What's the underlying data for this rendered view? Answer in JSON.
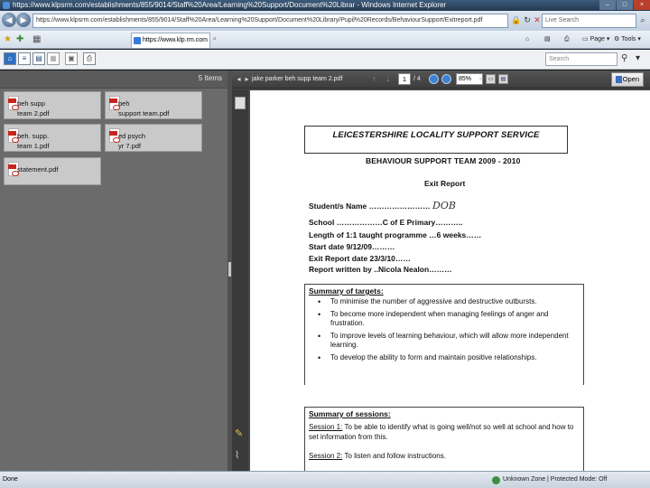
{
  "window": {
    "title": "https://www.klpsrm.com/establishments/855/9014/Staff%20Area/Learning%20Support/Document%20Librar - Windows Internet Explorer"
  },
  "address_bar": {
    "url": "https://www.klpsrm.com/establishments/855/9014/Staff%20Area/Learning%20Support/Document%20Library/Pupil%20Records/BehaviourSupport/Exitreport.pdf",
    "search_placeholder": "Live Search"
  },
  "browser_tab": {
    "label": "https://www.klp.rm.com"
  },
  "command_bar": {
    "page_label": "Page",
    "tools_label": "Tools"
  },
  "app_toolbar": {
    "search_placeholder": "Search"
  },
  "file_panel": {
    "item_count": "5 Items",
    "files": [
      {
        "name": "beh supp\nteam 2.pdf"
      },
      {
        "name": "beh\nsupport team.pdf"
      },
      {
        "name": "beh. supp.\nteam 1.pdf"
      },
      {
        "name": "ed psych\nyr 7.pdf"
      },
      {
        "name": "statement.pdf"
      }
    ]
  },
  "viewer": {
    "document_name": "jake parker beh supp team 2.pdf",
    "current_page": "1",
    "total_pages": "/ 4",
    "zoom": "85%",
    "open_button": "Open"
  },
  "document": {
    "organisation": "LEICESTERSHIRE LOCALITY SUPPORT SERVICE",
    "team_line": "BEHAVIOUR SUPPORT TEAM 2009 - 2010",
    "report_title": "Exit Report",
    "student_label": "Student/s Name",
    "student_dots": " ……………………",
    "student_value": "DOB",
    "school_line": "School ………………C of E Primary………..",
    "length_line": "Length of 1:1 taught programme …6 weeks……",
    "start_line": "Start date 9/12/09………",
    "exit_line": "Exit Report date 23/3/10……",
    "author_line": "Report written by ..Nicola Nealon………",
    "targets_heading": "Summary of targets:",
    "targets": [
      "To minimise the number of aggressive and destructive outbursts.",
      "To become more independent when managing feelings of anger and frustration.",
      "To improve levels of learning behaviour, which will allow more independent learning.",
      "To develop the ability to form and maintain positive relationships."
    ],
    "sessions_heading": "Summary of sessions:",
    "sessions": [
      {
        "label": "Session 1:",
        "text": " To be able to identify what is going well/not so well at school and how to set information from this."
      },
      {
        "label": "Session 2:",
        "text": "  To listen and follow instructions."
      }
    ]
  },
  "status_bar": {
    "status": "Done",
    "zone": "Unknown Zone | Protected Mode: Off"
  }
}
